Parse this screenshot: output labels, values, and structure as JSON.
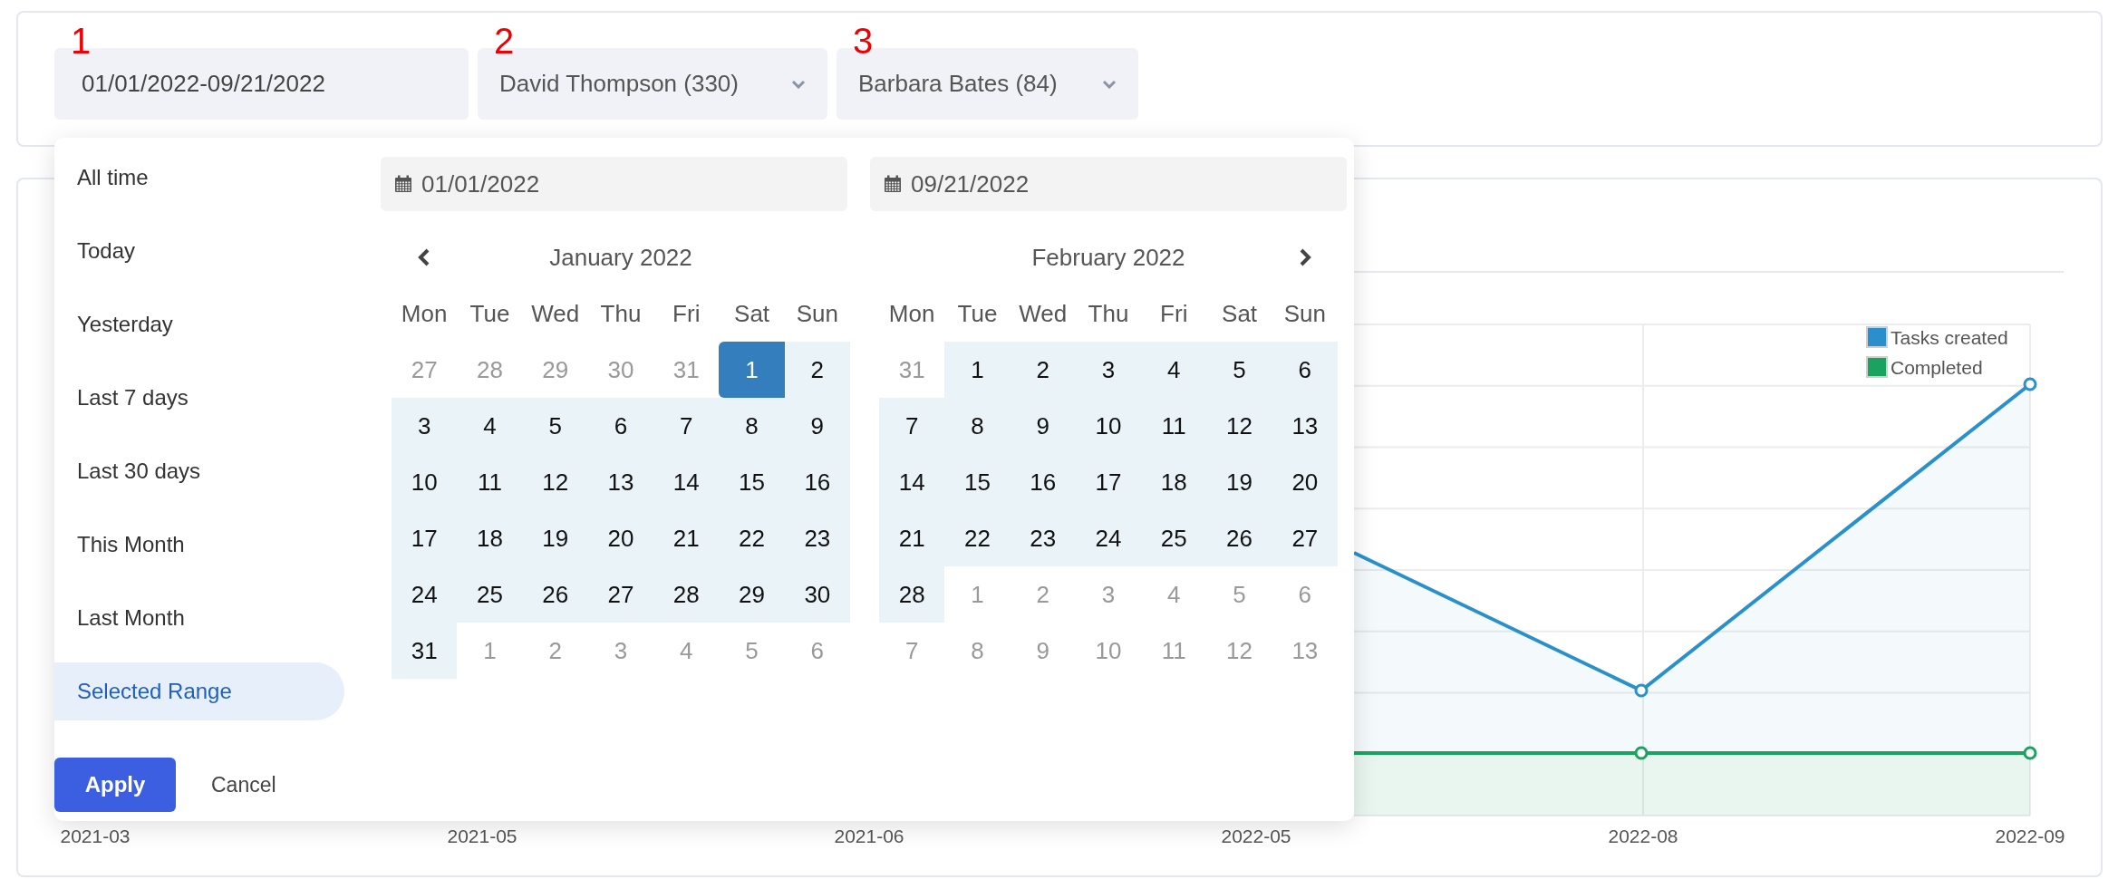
{
  "filters": [
    {
      "kind": "date_range",
      "value": "01/01/2022-09/21/2022",
      "marker": "1"
    },
    {
      "kind": "select",
      "value": "David Thompson (330)",
      "marker": "2"
    },
    {
      "kind": "select",
      "value": "Barbara Bates (84)",
      "marker": "3"
    }
  ],
  "date_picker": {
    "presets": [
      {
        "label": "All time",
        "selected": false
      },
      {
        "label": "Today",
        "selected": false
      },
      {
        "label": "Yesterday",
        "selected": false
      },
      {
        "label": "Last 7 days",
        "selected": false
      },
      {
        "label": "Last 30 days",
        "selected": false
      },
      {
        "label": "This Month",
        "selected": false
      },
      {
        "label": "Last Month",
        "selected": false
      },
      {
        "label": "Selected Range",
        "selected": true
      }
    ],
    "apply": "Apply",
    "cancel": "Cancel",
    "calendars": [
      {
        "input": "01/01/2022",
        "prev_arrow": true,
        "next_arrow": false,
        "month": "January 2022",
        "weekdays": [
          "Mon",
          "Tue",
          "Wed",
          "Thu",
          "Fri",
          "Sat",
          "Sun"
        ],
        "weeks": [
          [
            {
              "label": "27",
              "other_month": true,
              "in_range": false,
              "selected": false
            },
            {
              "label": "28",
              "other_month": true,
              "in_range": false,
              "selected": false
            },
            {
              "label": "29",
              "other_month": true,
              "in_range": false,
              "selected": false
            },
            {
              "label": "30",
              "other_month": true,
              "in_range": false,
              "selected": false
            },
            {
              "label": "31",
              "other_month": true,
              "in_range": false,
              "selected": false
            },
            {
              "label": "1",
              "other_month": false,
              "in_range": true,
              "selected": true
            },
            {
              "label": "2",
              "other_month": false,
              "in_range": true,
              "selected": false
            }
          ],
          [
            {
              "label": "3",
              "other_month": false,
              "in_range": true,
              "selected": false
            },
            {
              "label": "4",
              "other_month": false,
              "in_range": true,
              "selected": false
            },
            {
              "label": "5",
              "other_month": false,
              "in_range": true,
              "selected": false
            },
            {
              "label": "6",
              "other_month": false,
              "in_range": true,
              "selected": false
            },
            {
              "label": "7",
              "other_month": false,
              "in_range": true,
              "selected": false
            },
            {
              "label": "8",
              "other_month": false,
              "in_range": true,
              "selected": false
            },
            {
              "label": "9",
              "other_month": false,
              "in_range": true,
              "selected": false
            }
          ],
          [
            {
              "label": "10",
              "other_month": false,
              "in_range": true,
              "selected": false
            },
            {
              "label": "11",
              "other_month": false,
              "in_range": true,
              "selected": false
            },
            {
              "label": "12",
              "other_month": false,
              "in_range": true,
              "selected": false
            },
            {
              "label": "13",
              "other_month": false,
              "in_range": true,
              "selected": false
            },
            {
              "label": "14",
              "other_month": false,
              "in_range": true,
              "selected": false
            },
            {
              "label": "15",
              "other_month": false,
              "in_range": true,
              "selected": false
            },
            {
              "label": "16",
              "other_month": false,
              "in_range": true,
              "selected": false
            }
          ],
          [
            {
              "label": "17",
              "other_month": false,
              "in_range": true,
              "selected": false
            },
            {
              "label": "18",
              "other_month": false,
              "in_range": true,
              "selected": false
            },
            {
              "label": "19",
              "other_month": false,
              "in_range": true,
              "selected": false
            },
            {
              "label": "20",
              "other_month": false,
              "in_range": true,
              "selected": false
            },
            {
              "label": "21",
              "other_month": false,
              "in_range": true,
              "selected": false
            },
            {
              "label": "22",
              "other_month": false,
              "in_range": true,
              "selected": false
            },
            {
              "label": "23",
              "other_month": false,
              "in_range": true,
              "selected": false
            }
          ],
          [
            {
              "label": "24",
              "other_month": false,
              "in_range": true,
              "selected": false
            },
            {
              "label": "25",
              "other_month": false,
              "in_range": true,
              "selected": false
            },
            {
              "label": "26",
              "other_month": false,
              "in_range": true,
              "selected": false
            },
            {
              "label": "27",
              "other_month": false,
              "in_range": true,
              "selected": false
            },
            {
              "label": "28",
              "other_month": false,
              "in_range": true,
              "selected": false
            },
            {
              "label": "29",
              "other_month": false,
              "in_range": true,
              "selected": false
            },
            {
              "label": "30",
              "other_month": false,
              "in_range": true,
              "selected": false
            }
          ],
          [
            {
              "label": "31",
              "other_month": false,
              "in_range": true,
              "selected": false
            },
            {
              "label": "1",
              "other_month": true,
              "in_range": false,
              "selected": false
            },
            {
              "label": "2",
              "other_month": true,
              "in_range": false,
              "selected": false
            },
            {
              "label": "3",
              "other_month": true,
              "in_range": false,
              "selected": false
            },
            {
              "label": "4",
              "other_month": true,
              "in_range": false,
              "selected": false
            },
            {
              "label": "5",
              "other_month": true,
              "in_range": false,
              "selected": false
            },
            {
              "label": "6",
              "other_month": true,
              "in_range": false,
              "selected": false
            }
          ]
        ]
      },
      {
        "input": "09/21/2022",
        "prev_arrow": false,
        "next_arrow": true,
        "month": "February 2022",
        "weekdays": [
          "Mon",
          "Tue",
          "Wed",
          "Thu",
          "Fri",
          "Sat",
          "Sun"
        ],
        "weeks": [
          [
            {
              "label": "31",
              "other_month": true,
              "in_range": false,
              "selected": false
            },
            {
              "label": "1",
              "other_month": false,
              "in_range": true,
              "selected": false
            },
            {
              "label": "2",
              "other_month": false,
              "in_range": true,
              "selected": false
            },
            {
              "label": "3",
              "other_month": false,
              "in_range": true,
              "selected": false
            },
            {
              "label": "4",
              "other_month": false,
              "in_range": true,
              "selected": false
            },
            {
              "label": "5",
              "other_month": false,
              "in_range": true,
              "selected": false
            },
            {
              "label": "6",
              "other_month": false,
              "in_range": true,
              "selected": false
            }
          ],
          [
            {
              "label": "7",
              "other_month": false,
              "in_range": true,
              "selected": false
            },
            {
              "label": "8",
              "other_month": false,
              "in_range": true,
              "selected": false
            },
            {
              "label": "9",
              "other_month": false,
              "in_range": true,
              "selected": false
            },
            {
              "label": "10",
              "other_month": false,
              "in_range": true,
              "selected": false
            },
            {
              "label": "11",
              "other_month": false,
              "in_range": true,
              "selected": false
            },
            {
              "label": "12",
              "other_month": false,
              "in_range": true,
              "selected": false
            },
            {
              "label": "13",
              "other_month": false,
              "in_range": true,
              "selected": false
            }
          ],
          [
            {
              "label": "14",
              "other_month": false,
              "in_range": true,
              "selected": false
            },
            {
              "label": "15",
              "other_month": false,
              "in_range": true,
              "selected": false
            },
            {
              "label": "16",
              "other_month": false,
              "in_range": true,
              "selected": false
            },
            {
              "label": "17",
              "other_month": false,
              "in_range": true,
              "selected": false
            },
            {
              "label": "18",
              "other_month": false,
              "in_range": true,
              "selected": false
            },
            {
              "label": "19",
              "other_month": false,
              "in_range": true,
              "selected": false
            },
            {
              "label": "20",
              "other_month": false,
              "in_range": true,
              "selected": false
            }
          ],
          [
            {
              "label": "21",
              "other_month": false,
              "in_range": true,
              "selected": false
            },
            {
              "label": "22",
              "other_month": false,
              "in_range": true,
              "selected": false
            },
            {
              "label": "23",
              "other_month": false,
              "in_range": true,
              "selected": false
            },
            {
              "label": "24",
              "other_month": false,
              "in_range": true,
              "selected": false
            },
            {
              "label": "25",
              "other_month": false,
              "in_range": true,
              "selected": false
            },
            {
              "label": "26",
              "other_month": false,
              "in_range": true,
              "selected": false
            },
            {
              "label": "27",
              "other_month": false,
              "in_range": true,
              "selected": false
            }
          ],
          [
            {
              "label": "28",
              "other_month": false,
              "in_range": true,
              "selected": false
            },
            {
              "label": "1",
              "other_month": true,
              "in_range": false,
              "selected": false
            },
            {
              "label": "2",
              "other_month": true,
              "in_range": false,
              "selected": false
            },
            {
              "label": "3",
              "other_month": true,
              "in_range": false,
              "selected": false
            },
            {
              "label": "4",
              "other_month": true,
              "in_range": false,
              "selected": false
            },
            {
              "label": "5",
              "other_month": true,
              "in_range": false,
              "selected": false
            },
            {
              "label": "6",
              "other_month": true,
              "in_range": false,
              "selected": false
            }
          ],
          [
            {
              "label": "7",
              "other_month": true,
              "in_range": false,
              "selected": false
            },
            {
              "label": "8",
              "other_month": true,
              "in_range": false,
              "selected": false
            },
            {
              "label": "9",
              "other_month": true,
              "in_range": false,
              "selected": false
            },
            {
              "label": "10",
              "other_month": true,
              "in_range": false,
              "selected": false
            },
            {
              "label": "11",
              "other_month": true,
              "in_range": false,
              "selected": false
            },
            {
              "label": "12",
              "other_month": true,
              "in_range": false,
              "selected": false
            },
            {
              "label": "13",
              "other_month": true,
              "in_range": false,
              "selected": false
            }
          ]
        ]
      }
    ]
  },
  "chart": {
    "legend": [
      {
        "label": "Tasks created",
        "color": "#2a90cc"
      },
      {
        "label": "Completed",
        "color": "#1aa35f"
      }
    ],
    "x_labels": [
      "2021-03",
      "2021-05",
      "2021-06",
      "2022-05",
      "2022-08",
      "2022-09"
    ]
  }
}
